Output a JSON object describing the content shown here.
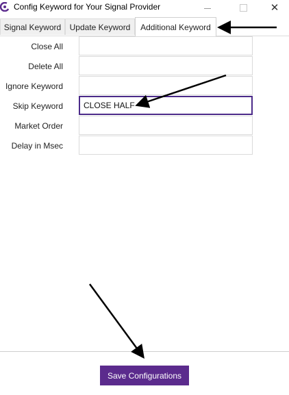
{
  "window": {
    "title": "Config Keyword for Your Signal Provider",
    "icon": "app-logo-icon",
    "minimize_icon": "minimize-icon",
    "maximize_icon": "maximize-icon",
    "close_label": "✕"
  },
  "tabs": [
    {
      "label": "Signal Keyword",
      "selected": false
    },
    {
      "label": "Update Keyword",
      "selected": false
    },
    {
      "label": "Additional Keyword",
      "selected": true
    }
  ],
  "form": {
    "rows": [
      {
        "label": "Close All",
        "value": ""
      },
      {
        "label": "Delete All",
        "value": ""
      },
      {
        "label": "Ignore Keyword",
        "value": ""
      },
      {
        "label": "Skip Keyword",
        "value": "CLOSE HALF"
      },
      {
        "label": "Market Order",
        "value": ""
      },
      {
        "label": "Delay in Msec",
        "value": ""
      }
    ]
  },
  "footer": {
    "save_label": "Save Configurations"
  },
  "colors": {
    "accent": "#5b2b8d",
    "focus_border": "#4b2a89",
    "annotation_arrow": "#000000"
  }
}
